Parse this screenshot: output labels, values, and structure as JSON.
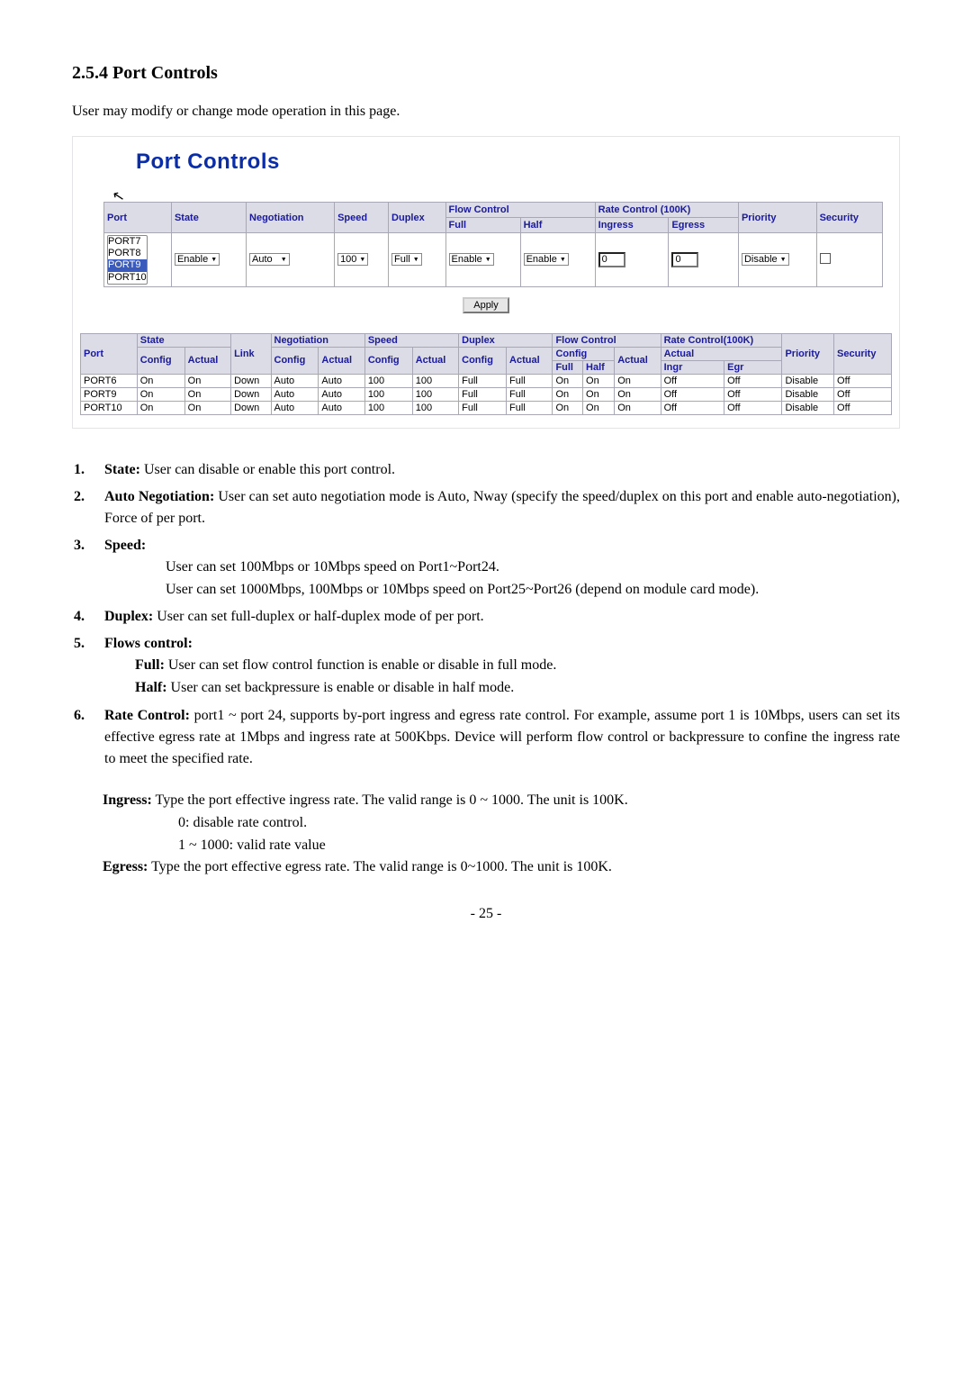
{
  "heading": "2.5.4 Port Controls",
  "intro": "User may modify or change mode operation in this page.",
  "panel_title": "Port Controls",
  "cursor_icon": "↖",
  "ctrl_headers": {
    "port": "Port",
    "state": "State",
    "negotiation": "Negotiation",
    "speed": "Speed",
    "duplex": "Duplex",
    "flow": "Flow Control",
    "full": "Full",
    "half": "Half",
    "rate": "Rate Control (100K)",
    "ingress": "Ingress",
    "egress": "Egress",
    "priority": "Priority",
    "security": "Security"
  },
  "port_list": [
    "PORT7",
    "PORT8",
    "PORT9",
    "PORT10"
  ],
  "ctrl_row": {
    "state": "Enable",
    "negotiation": "Auto",
    "speed": "100",
    "duplex": "Full",
    "flow_full": "Enable",
    "flow_half": "Enable",
    "ingress": "0",
    "egress": "0",
    "priority": "Disable"
  },
  "apply": "Apply",
  "status_headers": {
    "port": "Port",
    "state": "State",
    "link": "Link",
    "negotiation": "Negotiation",
    "speed": "Speed",
    "duplex": "Duplex",
    "flow": "Flow Control",
    "rate": "Rate Control(100K)",
    "priority": "Priority",
    "security": "Security",
    "config": "Config",
    "actual": "Actual",
    "full": "Full",
    "half": "Half",
    "ingr": "Ingr",
    "egr": "Egr"
  },
  "status_rows": [
    {
      "port": "PORT6",
      "sc": "On",
      "sa": "On",
      "link": "Down",
      "nc": "Auto",
      "na": "Auto",
      "spc": "100",
      "spa": "100",
      "dc": "Full",
      "da": "Full",
      "fcf": "On",
      "fch": "On",
      "fa": "On",
      "ri": "Off",
      "re": "Off",
      "pr": "Disable",
      "sec": "Off"
    },
    {
      "port": "PORT9",
      "sc": "On",
      "sa": "On",
      "link": "Down",
      "nc": "Auto",
      "na": "Auto",
      "spc": "100",
      "spa": "100",
      "dc": "Full",
      "da": "Full",
      "fcf": "On",
      "fch": "On",
      "fa": "On",
      "ri": "Off",
      "re": "Off",
      "pr": "Disable",
      "sec": "Off"
    },
    {
      "port": "PORT10",
      "sc": "On",
      "sa": "On",
      "link": "Down",
      "nc": "Auto",
      "na": "Auto",
      "spc": "100",
      "spa": "100",
      "dc": "Full",
      "da": "Full",
      "fcf": "On",
      "fch": "On",
      "fa": "On",
      "ri": "Off",
      "re": "Off",
      "pr": "Disable",
      "sec": "Off"
    }
  ],
  "notes": {
    "n1_label": "State:",
    "n1_text": " User can disable or enable this port control.",
    "n2_label": "Auto Negotiation:",
    "n2_text": " User can set auto negotiation mode is Auto, Nway (specify the speed/duplex on this port and enable auto-negotiation), Force of per port.",
    "n3_label": "Speed:",
    "n3_l1": "User can set 100Mbps or 10Mbps speed on Port1~Port24.",
    "n3_l2": "User can set 1000Mbps, 100Mbps or 10Mbps speed on Port25~Port26 (depend on module card mode).",
    "n4_label": "Duplex:",
    "n4_text": " User can set full-duplex or half-duplex mode of per port.",
    "n5_label": "Flows control:",
    "n5_full_label": "Full:",
    "n5_full_text": " User can set flow control function is enable or disable in full mode.",
    "n5_half_label": "Half:",
    "n5_half_text": " User can set backpressure is enable or disable in half mode.",
    "n6_label": "Rate Control:",
    "n6_text": " port1 ~ port 24, supports by-port ingress and egress rate control. For example, assume port 1 is 10Mbps, users can set its effective egress rate at 1Mbps and ingress rate at 500Kbps. Device will perform flow control or backpressure to confine the ingress rate to meet the specified rate.",
    "ingress_label": "Ingress:",
    "ingress_text": " Type the port effective ingress rate. The valid range is 0 ~ 1000. The unit is 100K.",
    "ingress_l1": "0: disable rate control.",
    "ingress_l2": "1 ~ 1000: valid rate value",
    "egress_label": "Egress:",
    "egress_text": " Type the port effective egress rate. The valid range is 0~1000. The unit is 100K."
  },
  "pagenum": "- 25 -"
}
